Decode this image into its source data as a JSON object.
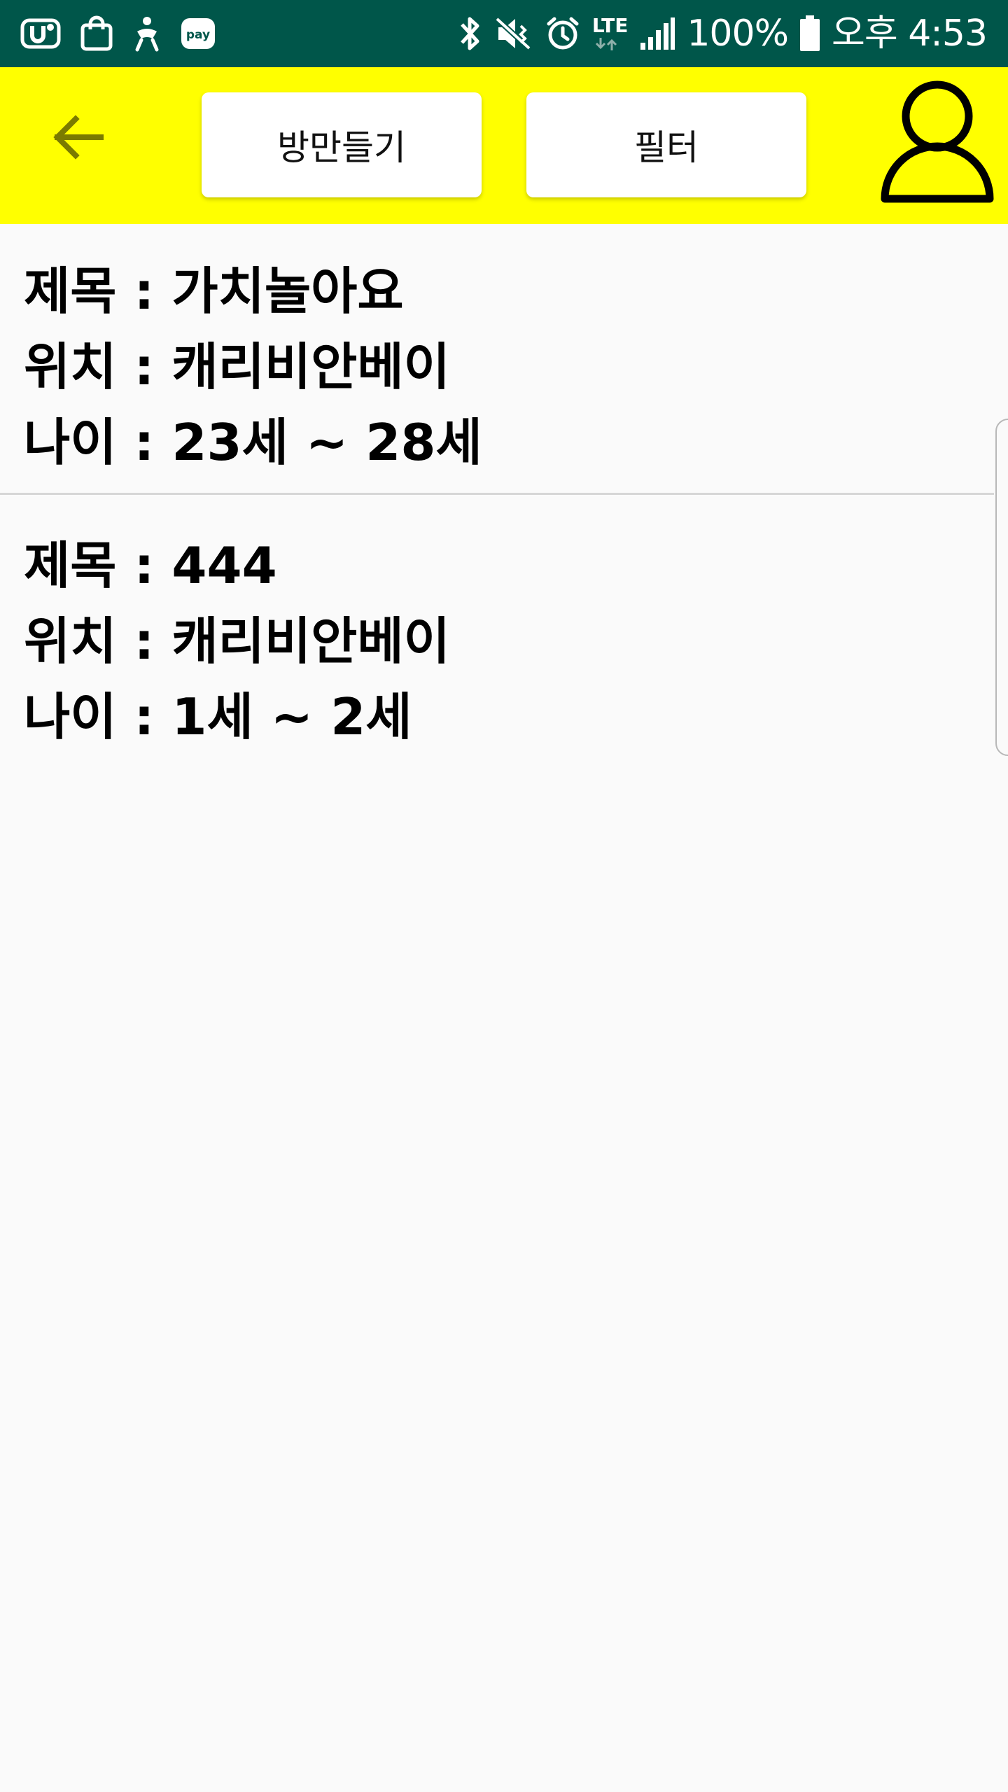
{
  "status_bar": {
    "battery": "100%",
    "time": "오후 4:53",
    "network": "LTE",
    "app_icons": [
      "u-plus-icon",
      "shopping-bag-icon",
      "assistant-icon",
      "pay-icon"
    ],
    "pay_label": "pay",
    "colors": {
      "background": "#00564a"
    }
  },
  "app_bar": {
    "make_room_label": "방만들기",
    "filter_label": "필터",
    "colors": {
      "background": "#ffff00",
      "back_arrow": "#7a7a00"
    }
  },
  "rooms": [
    {
      "title_line": "제목 : 가치놀아요",
      "location_line": "위치 : 캐리비안베이",
      "age_line": "나이 : 23세 ~ 28세"
    },
    {
      "title_line": "제목 : 444",
      "location_line": "위치 : 캐리비안베이",
      "age_line": "나이 : 1세 ~ 2세"
    }
  ]
}
